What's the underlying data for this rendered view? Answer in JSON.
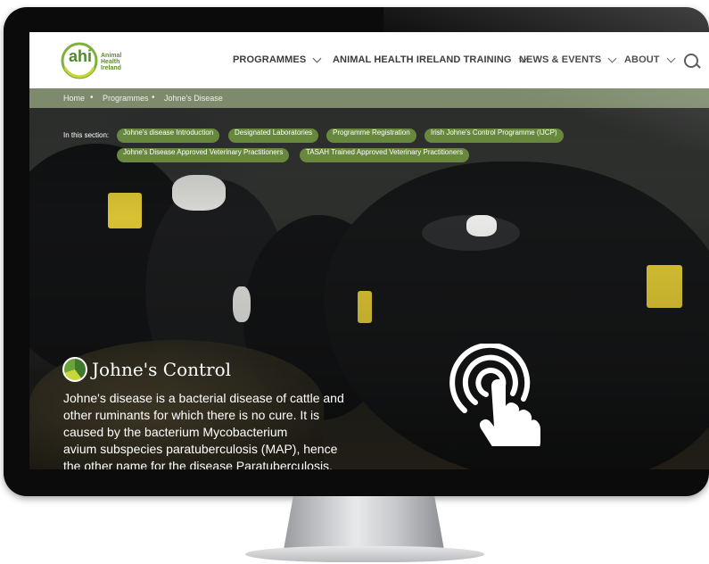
{
  "header": {
    "logo_text": "ahi",
    "logo_subtitle": "Animal Health Ireland",
    "nav": [
      {
        "label": "PROGRAMMES"
      },
      {
        "label": "ANIMAL HEALTH IRELAND TRAINING"
      },
      {
        "label": "NEWS & EVENTS"
      },
      {
        "label": "ABOUT"
      }
    ]
  },
  "breadcrumb": [
    "Home",
    "Programmes",
    "Johne's Disease"
  ],
  "section": {
    "label": "In this section:",
    "links": [
      "Johne's disease Introduction",
      "Designated Laboratories",
      "Programme Registration",
      "Irish Johne's Control Programme (IJCP)",
      "Johne's Disease Approved Veterinary Practitioners",
      "TASAH Trained Approved Veterinary Practitioners"
    ]
  },
  "hero": {
    "title": "Johne's Control",
    "body_lines": [
      "Johne's disease is a bacterial disease of cattle and",
      "other ruminants for which there is no cure. It is",
      "caused by the bacterium Mycobacterium",
      "avium subspecies paratuberculosis (MAP), hence",
      "the other name for the disease Paratuberculosis."
    ]
  },
  "colors": {
    "accent_green": "#67883d",
    "breadcrumb_bg": "#7d8b6c"
  },
  "icons": [
    "search-icon",
    "chevron-down-icon",
    "tap-hand-icon"
  ]
}
